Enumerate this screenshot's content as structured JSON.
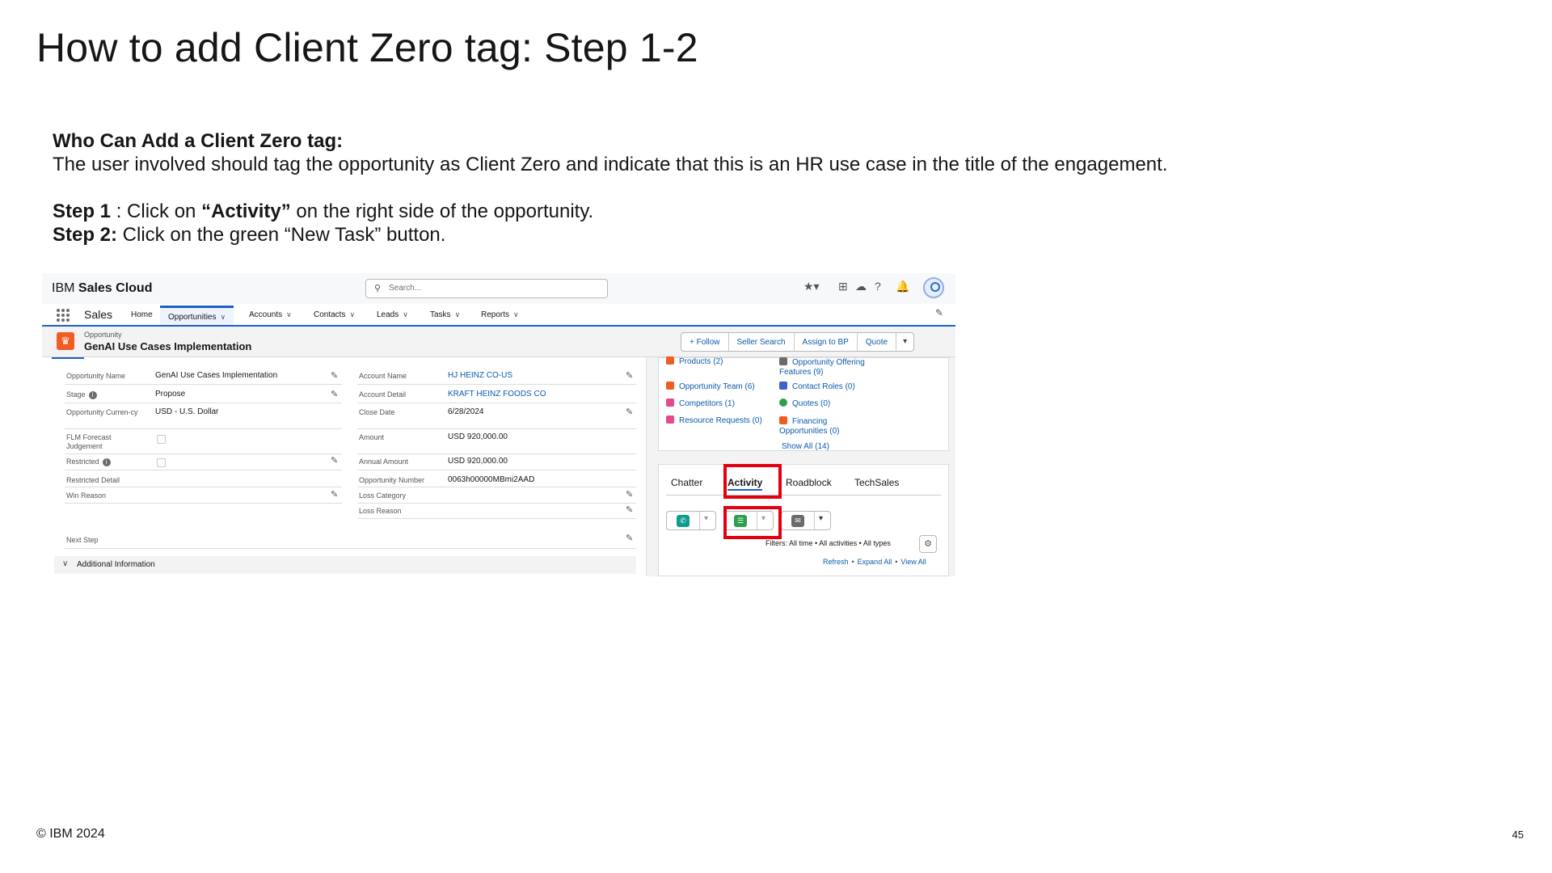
{
  "slide": {
    "title": "How to add Client Zero tag: Step 1-2",
    "who_heading": "Who Can Add a Client Zero tag:",
    "who_text": "The user involved should tag the opportunity as Client Zero and indicate that this is an HR use case in the title of the engagement.",
    "step1_label": "Step 1",
    "step1_pre": " : Click on ",
    "step1_bold": "“Activity”",
    "step1_post": " on the right side of the opportunity.",
    "step2_label": "Step 2:",
    "step2_text": " Click on the green “New Task” button.",
    "footer_copyright": "© IBM 2024",
    "page_number": "45"
  },
  "screenshot": {
    "brand_prefix": "IBM ",
    "brand_name": "Sales Cloud",
    "search_placeholder": "Search...",
    "app_name": "Sales",
    "nav": [
      "Home",
      "Opportunities",
      "Accounts",
      "Contacts",
      "Leads",
      "Tasks",
      "Reports"
    ],
    "record_type": "Opportunity",
    "record_name": "GenAI Use Cases Implementation",
    "actions": [
      "+ Follow",
      "Seller Search",
      "Assign to BP",
      "Quote"
    ],
    "fields_left": [
      {
        "label": "Opportunity Name",
        "value": "GenAI Use Cases Implementation"
      },
      {
        "label": "Stage",
        "value": "Propose"
      },
      {
        "label": "Opportunity Curren-cy",
        "value": "USD - U.S. Dollar"
      },
      {
        "label": "FLM Forecast Judgement",
        "value": ""
      },
      {
        "label": "Restricted",
        "value": ""
      },
      {
        "label": "Restricted Detail",
        "value": ""
      },
      {
        "label": "Win Reason",
        "value": ""
      },
      {
        "label": "Next Step",
        "value": ""
      }
    ],
    "fields_right": [
      {
        "label": "Account Name",
        "value": "HJ HEINZ CO-US"
      },
      {
        "label": "Account Detail",
        "value": "KRAFT HEINZ FOODS CO"
      },
      {
        "label": "Close Date",
        "value": "6/28/2024"
      },
      {
        "label": "Amount",
        "value": "USD 920,000.00"
      },
      {
        "label": "Annual Amount",
        "value": "USD 920,000.00"
      },
      {
        "label": "Opportunity Number",
        "value": "0063h00000MBmi2AAD"
      },
      {
        "label": "Loss Category",
        "value": ""
      },
      {
        "label": "Loss Reason",
        "value": ""
      }
    ],
    "additional_info": "Additional Information",
    "related": [
      "Products (2)",
      "Opportunity Offering Features (9)",
      "Opportunity Team (6)",
      "Contact Roles (0)",
      "Competitors (1)",
      "Quotes (0)",
      "Resource Requests (0)",
      "Financing Opportunities (0)"
    ],
    "show_all": "Show All (14)",
    "tabs": [
      "Chatter",
      "Activity",
      "Roadblock",
      "TechSales"
    ],
    "filters_text": "Filters: All time • All activities • All types",
    "links": [
      "Refresh",
      "Expand All",
      "View All"
    ],
    "colors": {
      "red_highlight": "#e3000f",
      "task_green": "#2e9e4f",
      "call_teal": "#0d9c8f",
      "accent_blue": "#1b5fc9"
    }
  }
}
